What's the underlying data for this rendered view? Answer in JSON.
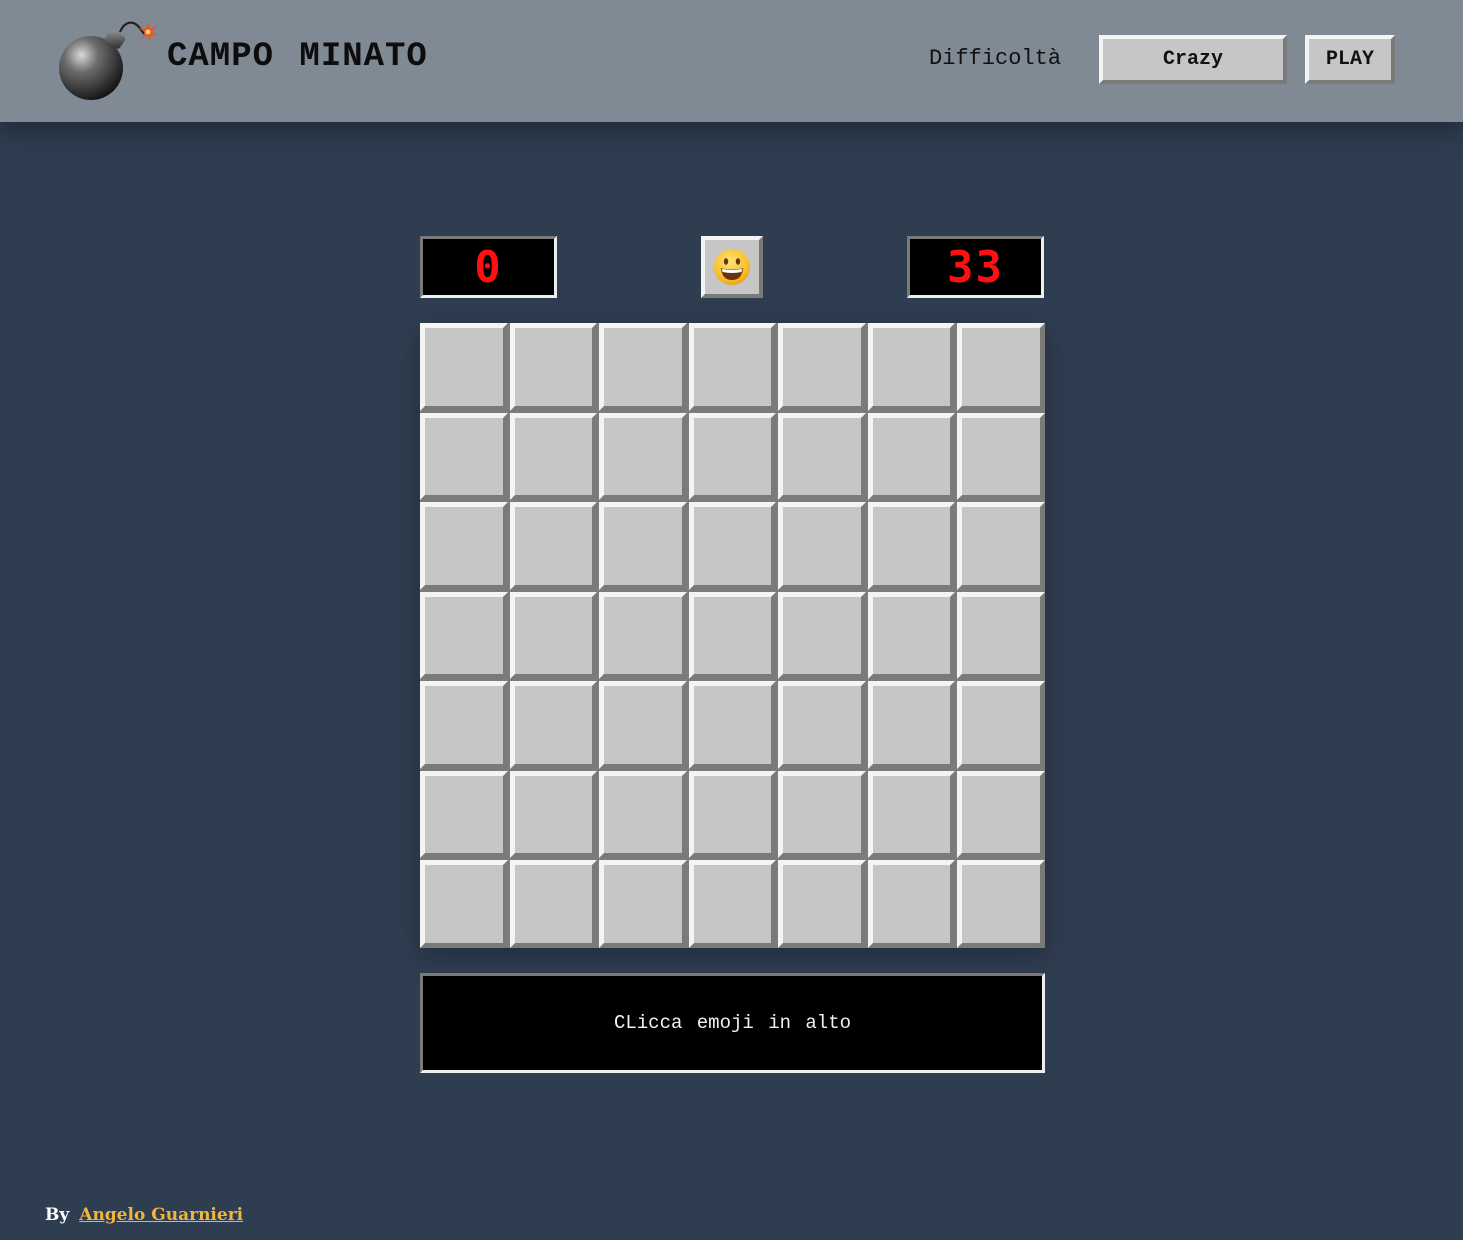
{
  "header": {
    "title": "CAMPO MINATO",
    "logo_icon": "bomb-icon",
    "difficulty_label": "Difficoltà",
    "difficulty_value": "Crazy",
    "play_label": "PLAY"
  },
  "game": {
    "mines_counter": "0",
    "timer": "33",
    "face_icon": "grinning-face-icon",
    "rows": 7,
    "cols": 7,
    "message": "CLicca emoji in alto"
  },
  "footer": {
    "by_label": "By",
    "author": "Angelo Guarnieri"
  },
  "colors": {
    "header_bg": "#808a95",
    "page_bg": "#2e3d50",
    "cell_bg": "#c6c6c6",
    "counter_digits": "#ff1010",
    "author_link": "#f3b43a"
  }
}
